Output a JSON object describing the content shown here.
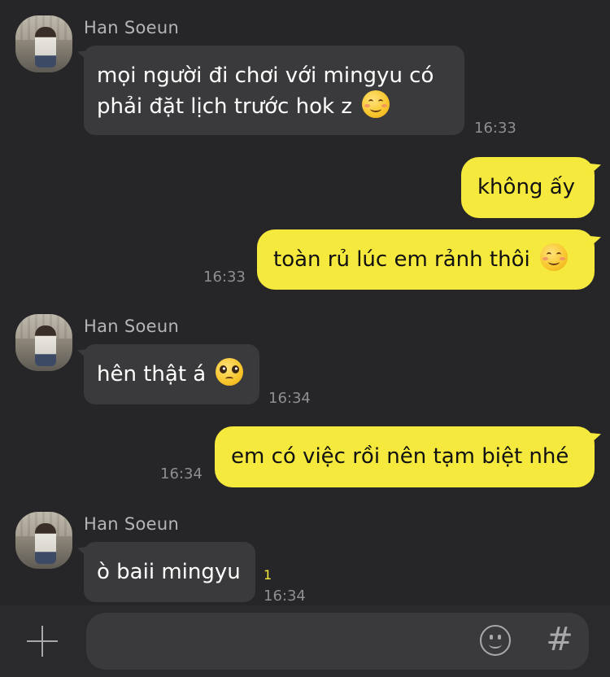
{
  "messages": [
    {
      "sender": "Han Soeun",
      "line1": "mọi người đi chơi với mingyu có",
      "line2": "phải đặt lịch trước hok z",
      "emoji": "relieved-face-emoji",
      "time": "16:33"
    },
    {
      "text": "không ấy"
    },
    {
      "text": "toàn rủ lúc em rảnh thôi",
      "emoji": "smiling-face-emoji",
      "time": "16:33"
    },
    {
      "sender": "Han Soeun",
      "text": "hên thật á",
      "emoji": "pleading-face-emoji",
      "time": "16:34"
    },
    {
      "text": "em có việc rồi nên tạm biệt nhé",
      "time": "16:34"
    },
    {
      "sender": "Han Soeun",
      "text": "ò baii mingyu",
      "unread": "1",
      "time": "16:34"
    }
  ],
  "composer": {
    "input_value": "",
    "hash_label": "#"
  },
  "colors": {
    "background": "#262628",
    "incoming_bubble": "#3a3a3c",
    "outgoing_bubble": "#f6e93d",
    "timestamp": "#8e8e93",
    "unread": "#f6e93d"
  }
}
